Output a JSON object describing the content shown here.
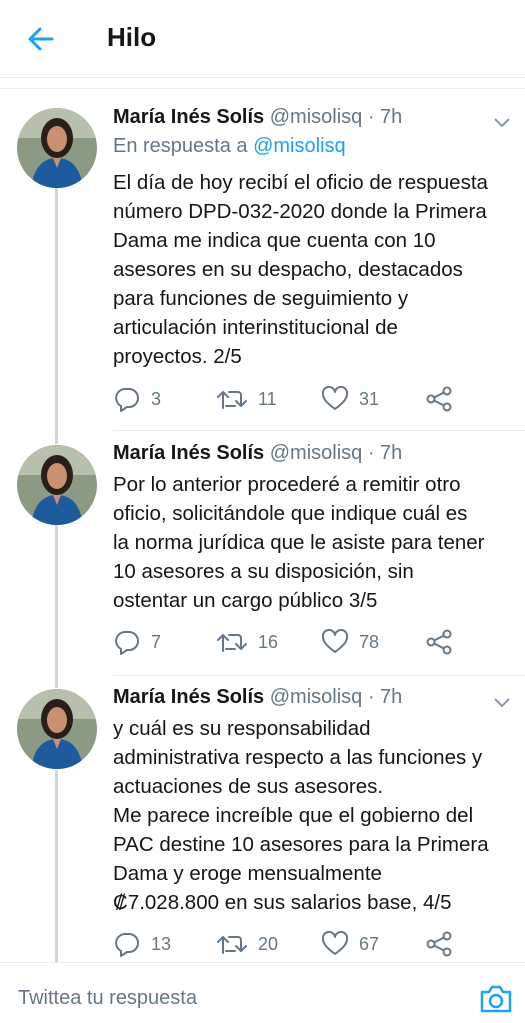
{
  "header": {
    "title": "Hilo"
  },
  "tweets": [
    {
      "name": "María Inés Solís",
      "handle": "@misolisq",
      "time": "· 7h",
      "reply_prefix": "En respuesta a",
      "reply_mention": "@misolisq",
      "lines": [
        "El día de hoy recibí el oficio de respuesta",
        "número DPD-032-2020 donde la Primera",
        "Dama me indica que cuenta con 10",
        "asesores en su despacho, destacados",
        "para funciones de seguimiento y",
        "articulación interinstitucional de",
        "proyectos. 2/5"
      ],
      "replies": "3",
      "retweets": "11",
      "likes": "31"
    },
    {
      "name": "María Inés Solís",
      "handle": "@misolisq",
      "time": "· 7h",
      "lines": [
        "Por lo anterior procederé a remitir otro",
        "oficio, solicitándole que indique cuál es",
        "la norma jurídica que le asiste para tener",
        "10 asesores a su disposición, sin",
        "ostentar un cargo público 3/5"
      ],
      "replies": "7",
      "retweets": "16",
      "likes": "78"
    },
    {
      "name": "María Inés Solís",
      "handle": "@misolisq",
      "time": "· 7h",
      "lines": [
        "y cuál es su responsabilidad",
        "administrativa respecto a las funciones y",
        "actuaciones de sus asesores.",
        "Me parece increíble que el gobierno del",
        "PAC destine 10 asesores para la Primera",
        "Dama y eroge mensualmente",
        "₡7.028.800 en sus salarios base, 4/5"
      ],
      "replies": "13",
      "retweets": "20",
      "likes": "67"
    }
  ],
  "composer": {
    "placeholder": "Twittea tu respuesta"
  },
  "colors": {
    "accent": "#1da1f2",
    "muted": "#657786",
    "text": "#14171a",
    "border": "#e6ecf0"
  },
  "icons": [
    "back-arrow-icon",
    "chevron-down-icon",
    "reply-icon",
    "retweet-icon",
    "like-icon",
    "share-icon",
    "camera-icon"
  ]
}
